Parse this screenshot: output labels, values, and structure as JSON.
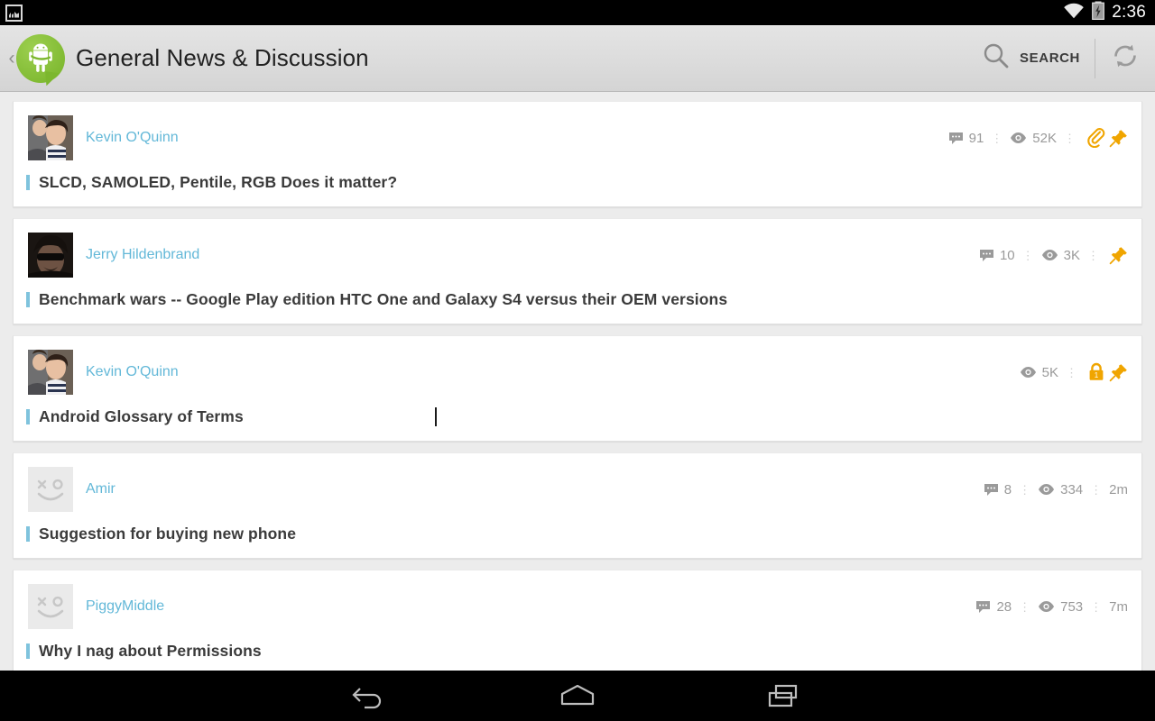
{
  "statusbar": {
    "left_icon": "gallery-icon",
    "wifi_icon": "wifi-icon",
    "battery_icon": "battery-charging-icon",
    "time": "2:36"
  },
  "actionbar": {
    "back_chevron": "‹",
    "logo_icon": "android-central-logo",
    "title": "General News & Discussion",
    "search_label": "SEARCH",
    "search_icon": "search-icon",
    "refresh_icon": "refresh-icon"
  },
  "threads": [
    {
      "author": "Kevin O'Quinn",
      "avatar": "photo-avatar",
      "title": "SLCD, SAMOLED, Pentile, RGB Does it matter?",
      "replies": "91",
      "views": "52K",
      "time": "",
      "badges": [
        "attachment-icon",
        "pin-icon"
      ]
    },
    {
      "author": "Jerry Hildenbrand",
      "avatar": "photo-avatar",
      "title": "Benchmark wars -- Google Play edition HTC One and Galaxy S4 versus their OEM versions",
      "replies": "10",
      "views": "3K",
      "time": "",
      "badges": [
        "pin-icon"
      ]
    },
    {
      "author": "Kevin O'Quinn",
      "avatar": "photo-avatar",
      "title": "Android Glossary of Terms",
      "replies": "",
      "views": "5K",
      "time": "",
      "badges": [
        "lock-icon",
        "pin-icon"
      ]
    },
    {
      "author": "Amir",
      "avatar": "placeholder-avatar",
      "title": "Suggestion for buying new phone",
      "replies": "8",
      "views": "334",
      "time": "2m",
      "badges": []
    },
    {
      "author": "PiggyMiddle",
      "avatar": "placeholder-avatar",
      "title": "Why I nag about Permissions",
      "replies": "28",
      "views": "753",
      "time": "7m",
      "badges": []
    }
  ],
  "navbar": {
    "back_icon": "back-arrow-icon",
    "home_icon": "home-icon",
    "recents_icon": "recent-apps-icon"
  },
  "colors": {
    "accent_bar": "#7fc3dd",
    "author_link": "#63b8d8",
    "badge_gold": "#f0a500",
    "brand_green": "#8dc63f",
    "page_bg": "#ececec"
  }
}
